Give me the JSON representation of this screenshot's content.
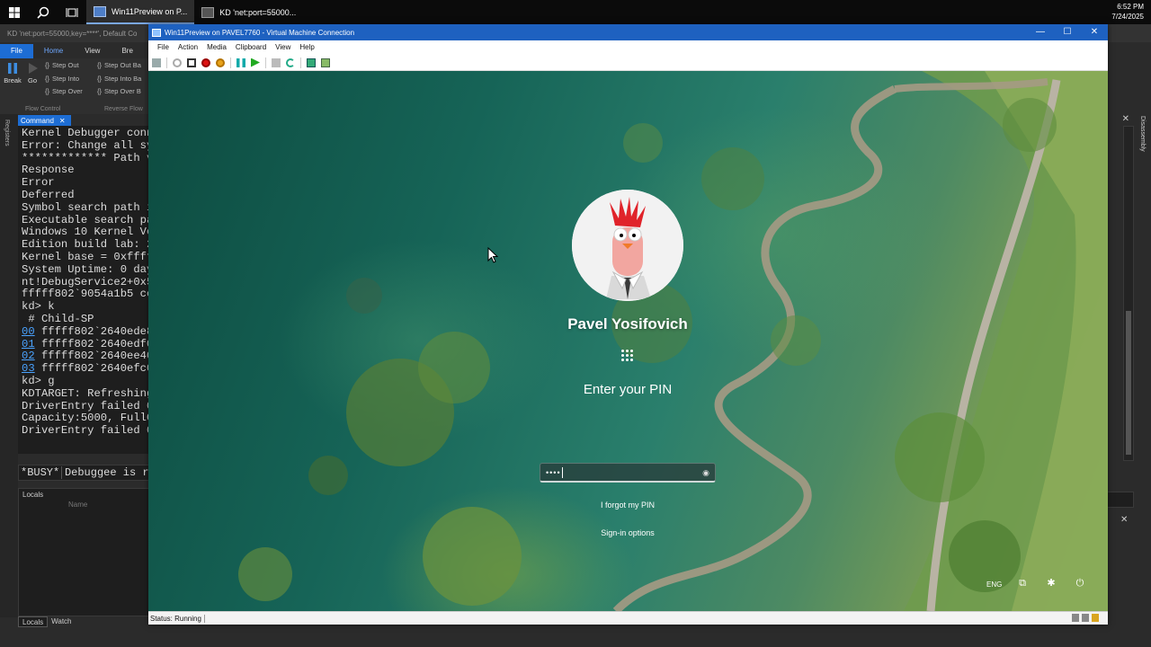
{
  "taskbar": {
    "apps": [
      {
        "label": "Win11Preview on P..."
      },
      {
        "label": "KD 'net:port=55000..."
      }
    ],
    "clock": {
      "time": "6:52 PM",
      "date": "7/24/2025"
    }
  },
  "debugger": {
    "title": "KD 'net:port=55000,key=****', Default Co",
    "ribbon_tabs": [
      "File",
      "Home",
      "View",
      "Bre"
    ],
    "ribbon": {
      "break_label": "Break",
      "go_label": "Go",
      "step_out": "Step Out",
      "step_into": "Step Into",
      "step_over": "Step Over",
      "step_out_back": "Step Out Ba",
      "step_into_back": "Step Into Ba",
      "step_over_back": "Step Over B",
      "group_flow": "Flow Control",
      "group_reverse": "Reverse Flow"
    },
    "registers_label": "Registers",
    "command_tab": "Command",
    "command_lines": [
      "Kernel Debugger conn",
      "Error: Change all sy",
      "",
      "************* Path v",
      "Response",
      "Error",
      "Deferred",
      "Symbol search path i",
      "Executable search pa",
      "Windows 10 Kernel Ve",
      "Edition build lab: 2",
      "Kernel base = 0xffff",
      "System Uptime: 0 day",
      "nt!DebugService2+0x5",
      "fffff802`9054a1b5 cc",
      "kd> k",
      " # Child-SP"
    ],
    "stack_rows": [
      {
        "num": "00",
        "addr": " fffff802`2640ede8"
      },
      {
        "num": "01",
        "addr": " fffff802`2640edf0"
      },
      {
        "num": "02",
        "addr": " fffff802`2640ee40"
      },
      {
        "num": "03",
        "addr": " fffff802`2640efc0"
      }
    ],
    "command_lines_after": [
      "kd> g",
      "KDTARGET: Refreshing",
      "DriverEntry failed 0",
      "Capacity:5000, FullC",
      "DriverEntry failed 0"
    ],
    "busy_label": "*BUSY*",
    "busy_text": "Debuggee is r",
    "locals_title": "Locals",
    "locals_col_name": "Name",
    "bottom_tabs": [
      "Locals",
      "Watch"
    ],
    "disassembly_label": "Disassembly"
  },
  "vm": {
    "title": "Win11Preview on PAVEL7760 - Virtual Machine Connection",
    "menu": [
      "File",
      "Action",
      "Media",
      "Clipboard",
      "View",
      "Help"
    ],
    "lock_screen": {
      "user_name": "Pavel Yosifovich",
      "pin_prompt": "Enter your PIN",
      "pin_masked": "••••",
      "forgot_pin": "I forgot my PIN",
      "sign_in_options": "Sign-in options",
      "language": "ENG"
    },
    "status": "Status: Running"
  }
}
